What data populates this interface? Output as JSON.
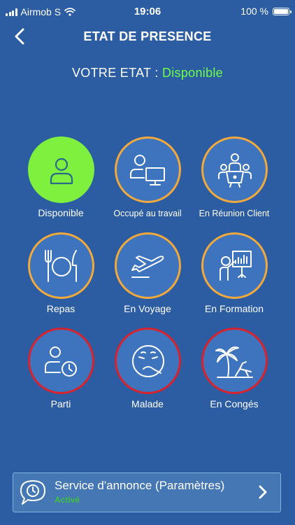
{
  "status_bar": {
    "carrier": "Airmob S",
    "time": "19:06",
    "battery": "100 %",
    "battery_level": 1.0
  },
  "nav": {
    "title": "ETAT DE PRESENCE",
    "back_icon": "chevron-left-icon"
  },
  "state": {
    "label": "VOTRE ETAT :",
    "value": "Disponible",
    "value_color": "#6dff45"
  },
  "tiles": [
    {
      "label": "Disponible",
      "icon": "person-icon",
      "ring": "active"
    },
    {
      "label": "Occupé au travail",
      "icon": "person-computer-icon",
      "ring": "orange"
    },
    {
      "label": "En Réunion Client",
      "icon": "meeting-icon",
      "ring": "orange"
    },
    {
      "label": "Repas",
      "icon": "fork-knife-plate-icon",
      "ring": "orange"
    },
    {
      "label": "En Voyage",
      "icon": "airplane-icon",
      "ring": "orange"
    },
    {
      "label": "En Formation",
      "icon": "presenter-board-icon",
      "ring": "orange"
    },
    {
      "label": "Parti",
      "icon": "person-clock-icon",
      "ring": "red"
    },
    {
      "label": "Malade",
      "icon": "sick-face-icon",
      "ring": "red"
    },
    {
      "label": "En Congés",
      "icon": "palm-beach-chair-icon",
      "ring": "red"
    }
  ],
  "colors": {
    "background": "#2c5da3",
    "tile_fill": "#3e74be",
    "ring_orange": "#f0a93a",
    "ring_red": "#d7232d",
    "active_fill": "#7ef03d",
    "active_text": "#3fc23a"
  },
  "announcement": {
    "title": "Service d'annonce (Paramètres)",
    "status": "Activé",
    "icon": "speech-bubble-clock-icon",
    "chevron_icon": "chevron-right-icon"
  }
}
